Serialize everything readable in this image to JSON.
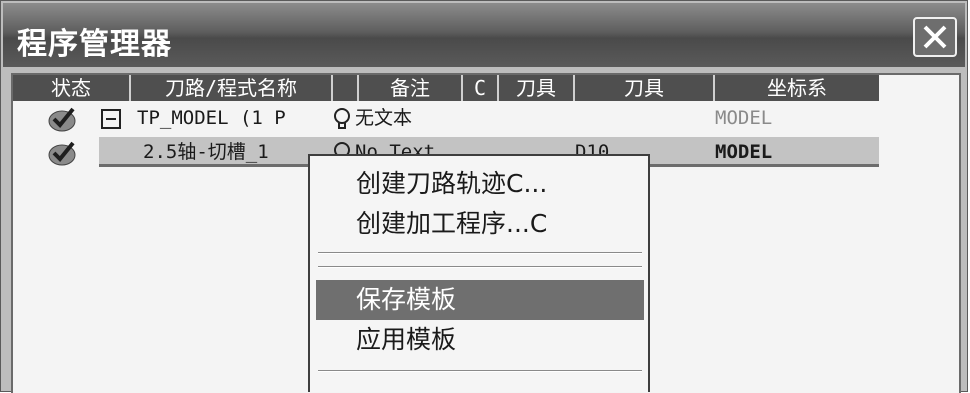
{
  "window": {
    "title": "程序管理器"
  },
  "table": {
    "columns": [
      "状态",
      "刀路/程式名称",
      "",
      "备注",
      "C",
      "刀具",
      "刀具",
      "坐标系"
    ],
    "rows": [
      {
        "name": "TP_MODEL (1 P",
        "note": "无文本",
        "tool": "",
        "coord": "MODEL"
      },
      {
        "name": "2.5轴-切槽_1",
        "note": "No Text",
        "tool": "D10",
        "coord": "MODEL"
      }
    ]
  },
  "context_menu": {
    "items": [
      "创建刀路轨迹C...",
      "创建加工程序...C",
      "保存模板",
      "应用模板"
    ],
    "selected": "保存模板"
  },
  "icons": [
    "close-icon",
    "checkmark-icon",
    "collapse-icon",
    "lightbulb-icon"
  ]
}
